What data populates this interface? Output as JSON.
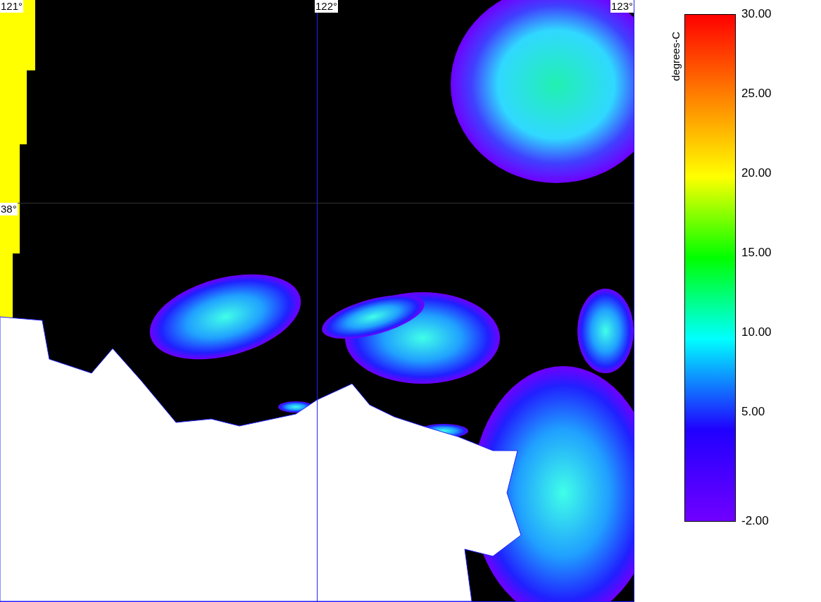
{
  "map": {
    "longitude_labels": [
      "121°",
      "122°",
      "123°"
    ],
    "latitude_labels": [
      "38°"
    ]
  },
  "colorbar": {
    "title": "degrees-C",
    "tick_labels": [
      "30.00",
      "25.00",
      "20.00",
      "15.00",
      "10.00",
      "5.00",
      "-2.00"
    ]
  }
}
